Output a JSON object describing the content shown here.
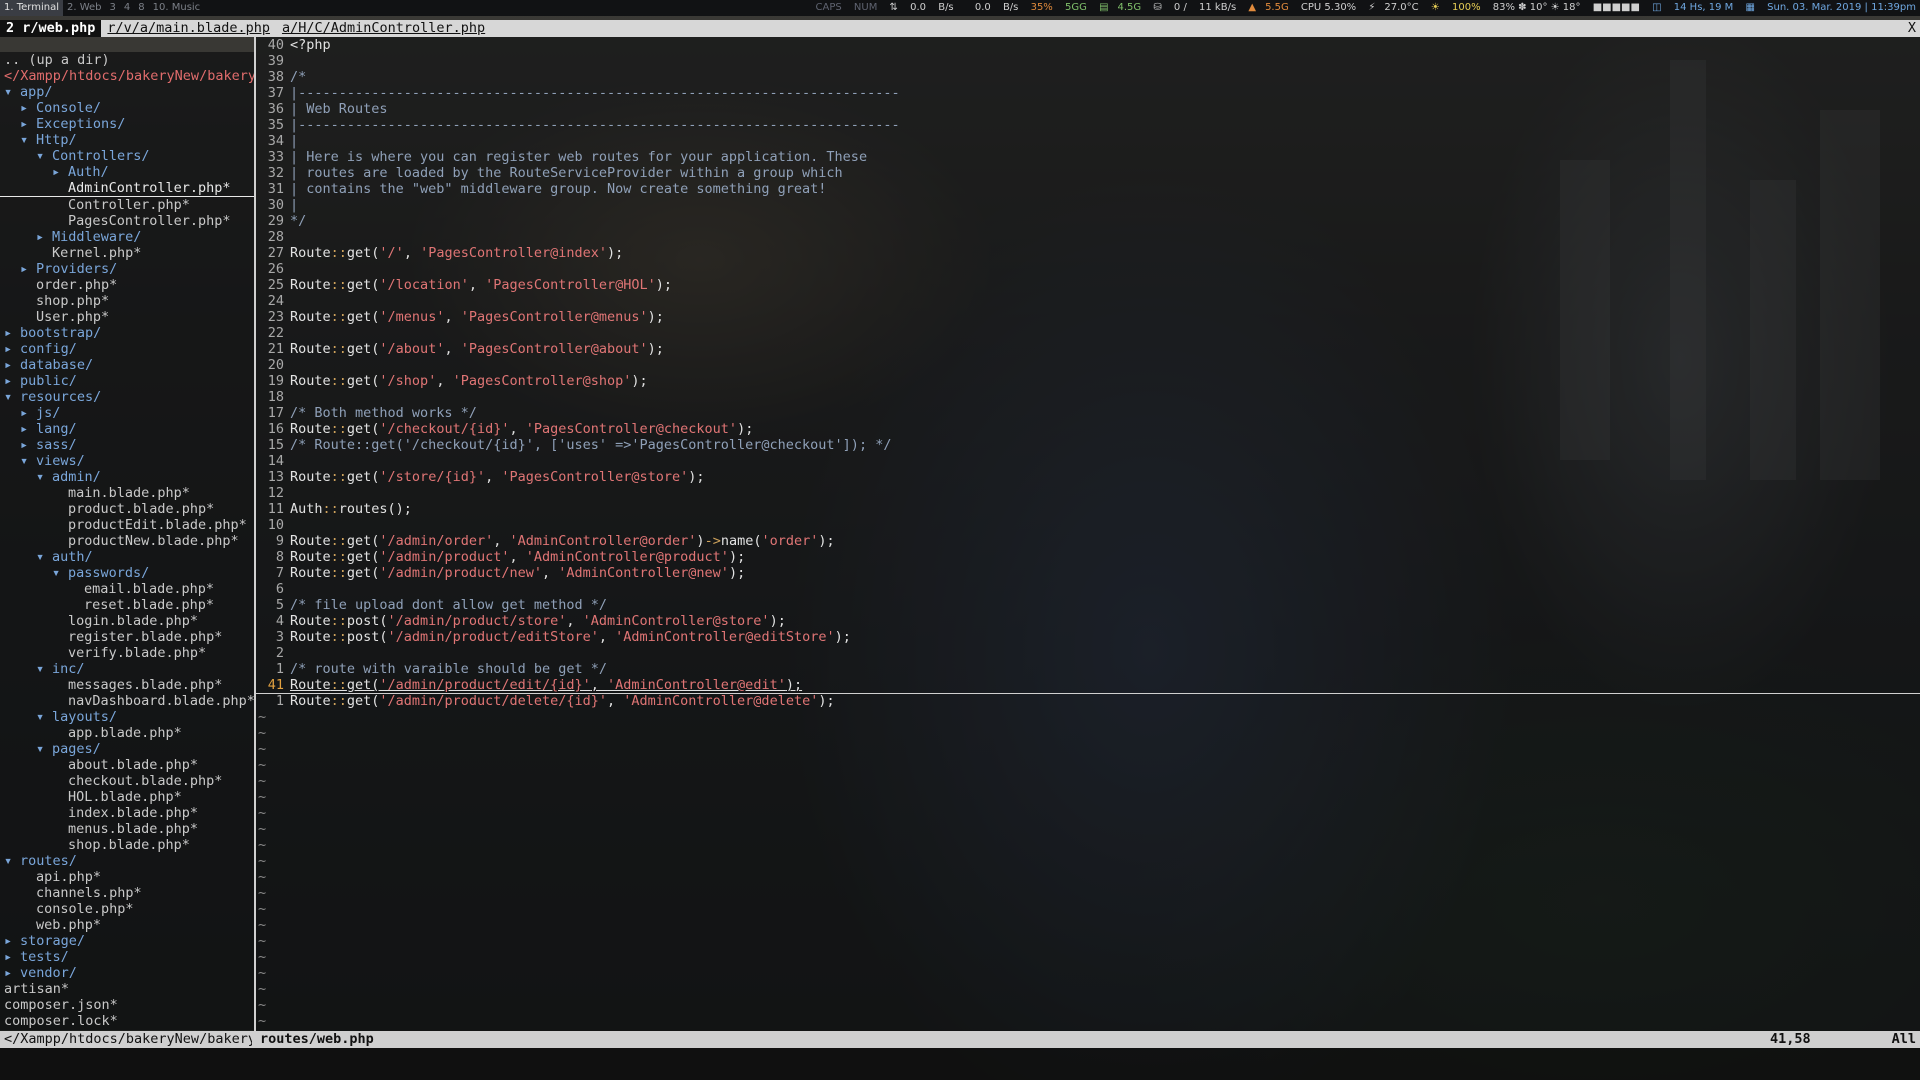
{
  "topbar": {
    "workspaces": [
      {
        "label": "1. Terminal",
        "active": true
      },
      {
        "label": "2. Web",
        "active": false
      },
      {
        "label": "3",
        "active": false
      },
      {
        "label": "4",
        "active": false
      },
      {
        "label": "8",
        "active": false
      },
      {
        "label": "10. Music",
        "active": false
      }
    ],
    "status": {
      "caps": "CAPS",
      "num": "NUM",
      "net_down": "0.0",
      "net_down_unit": "B/s",
      "net_up": "0.0",
      "net_up_unit": "B/s",
      "volume": "35%",
      "mem1": "5GG",
      "mem2": "4.5G",
      "disk_io": "0",
      "disk_speed": "11 kB/s",
      "ram": "5.5G",
      "cpu": "CPU 5.30%",
      "temp": "27.0°C",
      "brightness": "100%",
      "weather": "83% ✽ 10° ☀ 18°",
      "uptime": "14 Hs, 19 M",
      "datetime": "Sun. 03. Mar. 2019 | 11:39pm"
    }
  },
  "tabline": {
    "tabs": [
      {
        "label": "2 r/web.php",
        "selected": true
      },
      {
        "label": "r/v/a/main.blade.php",
        "selected": false
      },
      {
        "label": "a/H/C/AdminController.php",
        "selected": false
      }
    ],
    "close": "X"
  },
  "tree": [
    {
      "indent": 0,
      "arrow": "",
      "text": ".. (up a dir)",
      "kind": "file"
    },
    {
      "indent": 0,
      "arrow": "",
      "text": "</Xampp/htdocs/bakeryNew/bakery/",
      "kind": "cur"
    },
    {
      "indent": 0,
      "arrow": "▾",
      "text": "app/",
      "kind": "dir"
    },
    {
      "indent": 1,
      "arrow": "▸",
      "text": "Console/",
      "kind": "dir"
    },
    {
      "indent": 1,
      "arrow": "▸",
      "text": "Exceptions/",
      "kind": "dir"
    },
    {
      "indent": 1,
      "arrow": "▾",
      "text": "Http/",
      "kind": "dir"
    },
    {
      "indent": 2,
      "arrow": "▾",
      "text": "Controllers/",
      "kind": "dir"
    },
    {
      "indent": 3,
      "arrow": "▸",
      "text": "Auth/",
      "kind": "dir"
    },
    {
      "indent": 3,
      "arrow": "",
      "text": "AdminController.php*",
      "kind": "sel"
    },
    {
      "indent": 3,
      "arrow": "",
      "text": "Controller.php*",
      "kind": "file"
    },
    {
      "indent": 3,
      "arrow": "",
      "text": "PagesController.php*",
      "kind": "file"
    },
    {
      "indent": 2,
      "arrow": "▸",
      "text": "Middleware/",
      "kind": "dir"
    },
    {
      "indent": 2,
      "arrow": "",
      "text": "Kernel.php*",
      "kind": "file"
    },
    {
      "indent": 1,
      "arrow": "▸",
      "text": "Providers/",
      "kind": "dir"
    },
    {
      "indent": 1,
      "arrow": "",
      "text": "order.php*",
      "kind": "file"
    },
    {
      "indent": 1,
      "arrow": "",
      "text": "shop.php*",
      "kind": "file"
    },
    {
      "indent": 1,
      "arrow": "",
      "text": "User.php*",
      "kind": "file"
    },
    {
      "indent": 0,
      "arrow": "▸",
      "text": "bootstrap/",
      "kind": "dir"
    },
    {
      "indent": 0,
      "arrow": "▸",
      "text": "config/",
      "kind": "dir"
    },
    {
      "indent": 0,
      "arrow": "▸",
      "text": "database/",
      "kind": "dir"
    },
    {
      "indent": 0,
      "arrow": "▸",
      "text": "public/",
      "kind": "dir"
    },
    {
      "indent": 0,
      "arrow": "▾",
      "text": "resources/",
      "kind": "dir"
    },
    {
      "indent": 1,
      "arrow": "▸",
      "text": "js/",
      "kind": "dir"
    },
    {
      "indent": 1,
      "arrow": "▸",
      "text": "lang/",
      "kind": "dir"
    },
    {
      "indent": 1,
      "arrow": "▸",
      "text": "sass/",
      "kind": "dir"
    },
    {
      "indent": 1,
      "arrow": "▾",
      "text": "views/",
      "kind": "dir"
    },
    {
      "indent": 2,
      "arrow": "▾",
      "text": "admin/",
      "kind": "dir"
    },
    {
      "indent": 3,
      "arrow": "",
      "text": "main.blade.php*",
      "kind": "file"
    },
    {
      "indent": 3,
      "arrow": "",
      "text": "product.blade.php*",
      "kind": "file"
    },
    {
      "indent": 3,
      "arrow": "",
      "text": "productEdit.blade.php*",
      "kind": "file"
    },
    {
      "indent": 3,
      "arrow": "",
      "text": "productNew.blade.php*",
      "kind": "file"
    },
    {
      "indent": 2,
      "arrow": "▾",
      "text": "auth/",
      "kind": "dir"
    },
    {
      "indent": 3,
      "arrow": "▾",
      "text": "passwords/",
      "kind": "dir"
    },
    {
      "indent": 4,
      "arrow": "",
      "text": "email.blade.php*",
      "kind": "file"
    },
    {
      "indent": 4,
      "arrow": "",
      "text": "reset.blade.php*",
      "kind": "file"
    },
    {
      "indent": 3,
      "arrow": "",
      "text": "login.blade.php*",
      "kind": "file"
    },
    {
      "indent": 3,
      "arrow": "",
      "text": "register.blade.php*",
      "kind": "file"
    },
    {
      "indent": 3,
      "arrow": "",
      "text": "verify.blade.php*",
      "kind": "file"
    },
    {
      "indent": 2,
      "arrow": "▾",
      "text": "inc/",
      "kind": "dir"
    },
    {
      "indent": 3,
      "arrow": "",
      "text": "messages.blade.php*",
      "kind": "file"
    },
    {
      "indent": 3,
      "arrow": "",
      "text": "navDashboard.blade.php*",
      "kind": "file"
    },
    {
      "indent": 2,
      "arrow": "▾",
      "text": "layouts/",
      "kind": "dir"
    },
    {
      "indent": 3,
      "arrow": "",
      "text": "app.blade.php*",
      "kind": "file"
    },
    {
      "indent": 2,
      "arrow": "▾",
      "text": "pages/",
      "kind": "dir"
    },
    {
      "indent": 3,
      "arrow": "",
      "text": "about.blade.php*",
      "kind": "file"
    },
    {
      "indent": 3,
      "arrow": "",
      "text": "checkout.blade.php*",
      "kind": "file"
    },
    {
      "indent": 3,
      "arrow": "",
      "text": "HOL.blade.php*",
      "kind": "file"
    },
    {
      "indent": 3,
      "arrow": "",
      "text": "index.blade.php*",
      "kind": "file"
    },
    {
      "indent": 3,
      "arrow": "",
      "text": "menus.blade.php*",
      "kind": "file"
    },
    {
      "indent": 3,
      "arrow": "",
      "text": "shop.blade.php*",
      "kind": "file"
    },
    {
      "indent": 0,
      "arrow": "▾",
      "text": "routes/",
      "kind": "dir"
    },
    {
      "indent": 1,
      "arrow": "",
      "text": "api.php*",
      "kind": "file"
    },
    {
      "indent": 1,
      "arrow": "",
      "text": "channels.php*",
      "kind": "file"
    },
    {
      "indent": 1,
      "arrow": "",
      "text": "console.php*",
      "kind": "file"
    },
    {
      "indent": 1,
      "arrow": "",
      "text": "web.php*",
      "kind": "file"
    },
    {
      "indent": 0,
      "arrow": "▸",
      "text": "storage/",
      "kind": "dir"
    },
    {
      "indent": 0,
      "arrow": "▸",
      "text": "tests/",
      "kind": "dir"
    },
    {
      "indent": 0,
      "arrow": "▸",
      "text": "vendor/",
      "kind": "dir"
    },
    {
      "indent": 0,
      "arrow": "",
      "text": "artisan*",
      "kind": "file"
    },
    {
      "indent": 0,
      "arrow": "",
      "text": "composer.json*",
      "kind": "file"
    },
    {
      "indent": 0,
      "arrow": "",
      "text": "composer.lock*",
      "kind": "file"
    }
  ],
  "editor": {
    "lines": [
      {
        "ln": "40",
        "code": "<?php"
      },
      {
        "ln": "39",
        "code": ""
      },
      {
        "ln": "38",
        "code": "/*"
      },
      {
        "ln": "37",
        "code": "|--------------------------------------------------------------------------"
      },
      {
        "ln": "36",
        "code": "| Web Routes"
      },
      {
        "ln": "35",
        "code": "|--------------------------------------------------------------------------"
      },
      {
        "ln": "34",
        "code": "|"
      },
      {
        "ln": "33",
        "code": "| Here is where you can register web routes for your application. These"
      },
      {
        "ln": "32",
        "code": "| routes are loaded by the RouteServiceProvider within a group which"
      },
      {
        "ln": "31",
        "code": "| contains the \"web\" middleware group. Now create something great!"
      },
      {
        "ln": "30",
        "code": "|"
      },
      {
        "ln": "29",
        "code": "*/"
      },
      {
        "ln": "28",
        "code": ""
      },
      {
        "ln": "27",
        "code": "Route::get('/', 'PagesController@index');"
      },
      {
        "ln": "26",
        "code": ""
      },
      {
        "ln": "25",
        "code": "Route::get('/location', 'PagesController@HOL');"
      },
      {
        "ln": "24",
        "code": ""
      },
      {
        "ln": "23",
        "code": "Route::get('/menus', 'PagesController@menus');"
      },
      {
        "ln": "22",
        "code": ""
      },
      {
        "ln": "21",
        "code": "Route::get('/about', 'PagesController@about');"
      },
      {
        "ln": "20",
        "code": ""
      },
      {
        "ln": "19",
        "code": "Route::get('/shop', 'PagesController@shop');"
      },
      {
        "ln": "18",
        "code": ""
      },
      {
        "ln": "17",
        "code": "/* Both method works */"
      },
      {
        "ln": "16",
        "code": "Route::get('/checkout/{id}', 'PagesController@checkout');"
      },
      {
        "ln": "15",
        "code": "/* Route::get('/checkout/{id}', ['uses' =>'PagesController@checkout']); */"
      },
      {
        "ln": "14",
        "code": ""
      },
      {
        "ln": "13",
        "code": "Route::get('/store/{id}', 'PagesController@store');"
      },
      {
        "ln": "12",
        "code": ""
      },
      {
        "ln": "11",
        "code": "Auth::routes();"
      },
      {
        "ln": "10",
        "code": ""
      },
      {
        "ln": "9",
        "code": "Route::get('/admin/order', 'AdminController@order')->name('order');"
      },
      {
        "ln": "8",
        "code": "Route::get('/admin/product', 'AdminController@product');"
      },
      {
        "ln": "7",
        "code": "Route::get('/admin/product/new', 'AdminController@new');"
      },
      {
        "ln": "6",
        "code": ""
      },
      {
        "ln": "5",
        "code": "/* file upload dont allow get method */"
      },
      {
        "ln": "4",
        "code": "Route::post('/admin/product/store', 'AdminController@store');"
      },
      {
        "ln": "3",
        "code": "Route::post('/admin/product/editStore', 'AdminController@editStore');"
      },
      {
        "ln": "2",
        "code": ""
      },
      {
        "ln": "1",
        "code": "/* route with varaible should be get */"
      },
      {
        "ln": "41",
        "code": "Route::get('/admin/product/edit/{id}', 'AdminController@edit');",
        "current": true
      },
      {
        "ln": "1",
        "code": "Route::get('/admin/product/delete/{id}', 'AdminController@delete');"
      }
    ],
    "tilde_count": 20,
    "tilde": "~"
  },
  "statusline": {
    "left": "</Xampp/htdocs/bakeryNew/bakery",
    "file": "routes/web.php",
    "position": "41,58",
    "percent": "All"
  }
}
